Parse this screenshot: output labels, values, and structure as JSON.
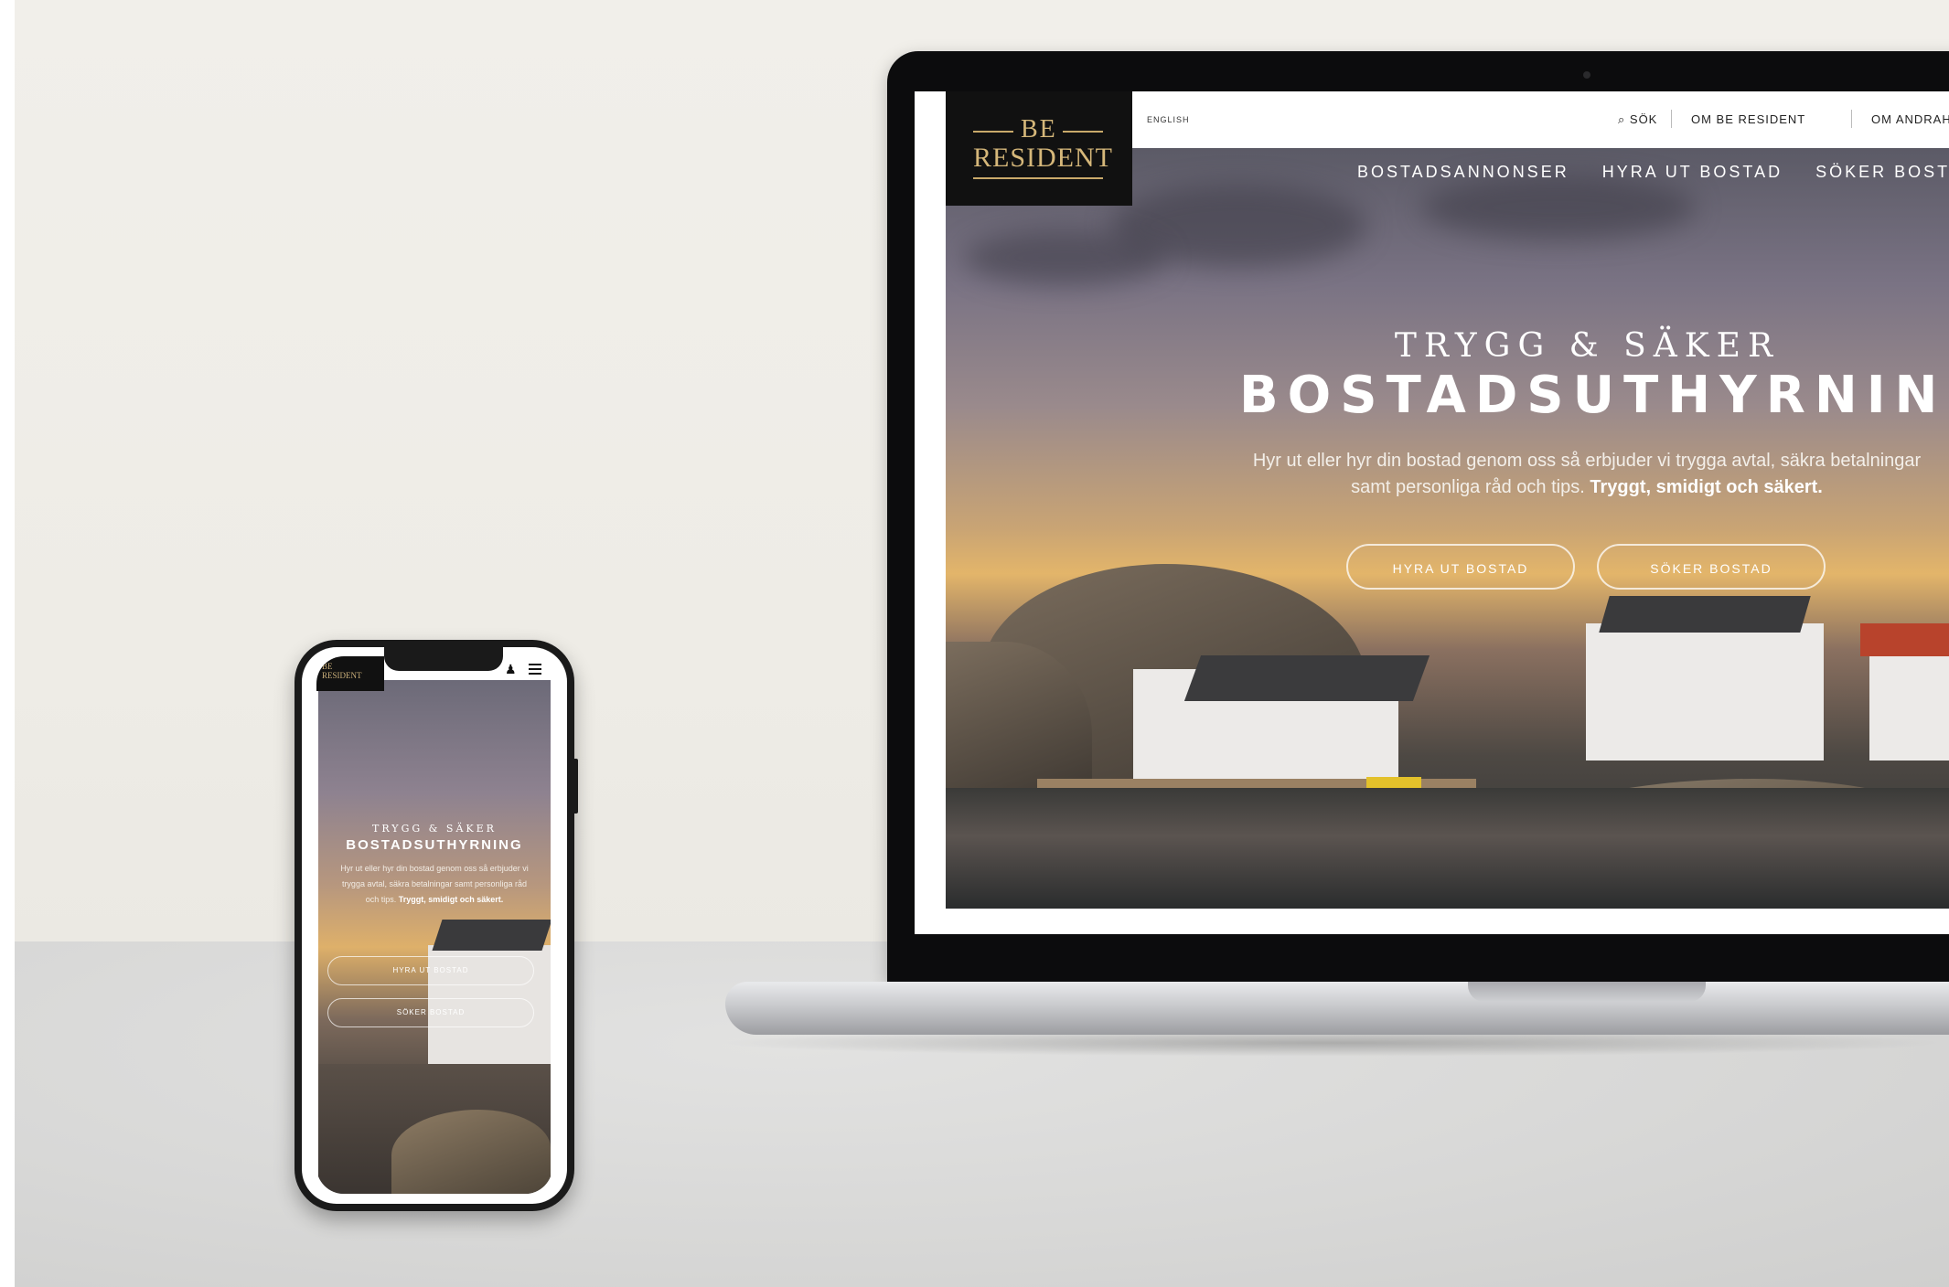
{
  "site": {
    "logo_line1": "BE",
    "logo_line2": "RESIDENT",
    "language_link": "ENGLISH",
    "topbar": {
      "search": "⌕ SÖK",
      "about": "OM BE RESIDENT",
      "about_partial": "OM ANDRAH"
    },
    "nav": [
      "BOSTADSANNONSER",
      "HYRA UT BOSTAD",
      "SÖKER BOST"
    ],
    "hero": {
      "kicker": "TRYGG & SÄKER",
      "title": "BOSTADSUTHYRNING",
      "body_regular": "Hyr ut eller hyr din bostad genom oss så erbjuder vi trygga avtal, säkra betalningar samt personliga råd och tips.",
      "body_bold": "Tryggt, smidigt och säkert.",
      "btn_rent_out": "HYRA UT BOSTAD",
      "btn_seek": "SÖKER BOSTAD"
    }
  },
  "mobile": {
    "logo_line1": "BE",
    "logo_line2": "RESIDENT",
    "user_icon": "user-icon",
    "menu_icon": "hamburger-icon",
    "kicker": "TRYGG & SÄKER",
    "title": "BOSTADSUTHYRNING",
    "body_regular": "Hyr ut eller hyr din bostad genom oss så erbjuder vi trygga avtal, säkra betalningar samt personliga råd och tips.",
    "body_bold": "Tryggt, smidigt och säkert.",
    "btn_rent_out": "HYRA UT BOSTAD",
    "btn_seek": "SÖKER BOSTAD"
  },
  "colors": {
    "logo_gold": "#d5b77a",
    "logo_bg": "#111111",
    "hero_text": "#ffffff"
  }
}
